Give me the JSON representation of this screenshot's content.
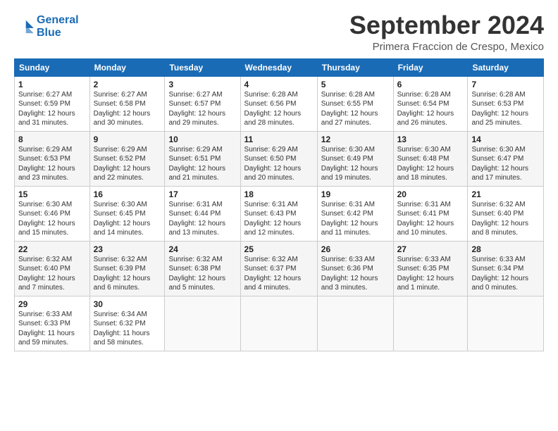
{
  "logo": {
    "line1": "General",
    "line2": "Blue"
  },
  "title": "September 2024",
  "subtitle": "Primera Fraccion de Crespo, Mexico",
  "weekdays": [
    "Sunday",
    "Monday",
    "Tuesday",
    "Wednesday",
    "Thursday",
    "Friday",
    "Saturday"
  ],
  "weeks": [
    [
      {
        "day": "1",
        "info": "Sunrise: 6:27 AM\nSunset: 6:59 PM\nDaylight: 12 hours\nand 31 minutes."
      },
      {
        "day": "2",
        "info": "Sunrise: 6:27 AM\nSunset: 6:58 PM\nDaylight: 12 hours\nand 30 minutes."
      },
      {
        "day": "3",
        "info": "Sunrise: 6:27 AM\nSunset: 6:57 PM\nDaylight: 12 hours\nand 29 minutes."
      },
      {
        "day": "4",
        "info": "Sunrise: 6:28 AM\nSunset: 6:56 PM\nDaylight: 12 hours\nand 28 minutes."
      },
      {
        "day": "5",
        "info": "Sunrise: 6:28 AM\nSunset: 6:55 PM\nDaylight: 12 hours\nand 27 minutes."
      },
      {
        "day": "6",
        "info": "Sunrise: 6:28 AM\nSunset: 6:54 PM\nDaylight: 12 hours\nand 26 minutes."
      },
      {
        "day": "7",
        "info": "Sunrise: 6:28 AM\nSunset: 6:53 PM\nDaylight: 12 hours\nand 25 minutes."
      }
    ],
    [
      {
        "day": "8",
        "info": "Sunrise: 6:29 AM\nSunset: 6:53 PM\nDaylight: 12 hours\nand 23 minutes."
      },
      {
        "day": "9",
        "info": "Sunrise: 6:29 AM\nSunset: 6:52 PM\nDaylight: 12 hours\nand 22 minutes."
      },
      {
        "day": "10",
        "info": "Sunrise: 6:29 AM\nSunset: 6:51 PM\nDaylight: 12 hours\nand 21 minutes."
      },
      {
        "day": "11",
        "info": "Sunrise: 6:29 AM\nSunset: 6:50 PM\nDaylight: 12 hours\nand 20 minutes."
      },
      {
        "day": "12",
        "info": "Sunrise: 6:30 AM\nSunset: 6:49 PM\nDaylight: 12 hours\nand 19 minutes."
      },
      {
        "day": "13",
        "info": "Sunrise: 6:30 AM\nSunset: 6:48 PM\nDaylight: 12 hours\nand 18 minutes."
      },
      {
        "day": "14",
        "info": "Sunrise: 6:30 AM\nSunset: 6:47 PM\nDaylight: 12 hours\nand 17 minutes."
      }
    ],
    [
      {
        "day": "15",
        "info": "Sunrise: 6:30 AM\nSunset: 6:46 PM\nDaylight: 12 hours\nand 15 minutes."
      },
      {
        "day": "16",
        "info": "Sunrise: 6:30 AM\nSunset: 6:45 PM\nDaylight: 12 hours\nand 14 minutes."
      },
      {
        "day": "17",
        "info": "Sunrise: 6:31 AM\nSunset: 6:44 PM\nDaylight: 12 hours\nand 13 minutes."
      },
      {
        "day": "18",
        "info": "Sunrise: 6:31 AM\nSunset: 6:43 PM\nDaylight: 12 hours\nand 12 minutes."
      },
      {
        "day": "19",
        "info": "Sunrise: 6:31 AM\nSunset: 6:42 PM\nDaylight: 12 hours\nand 11 minutes."
      },
      {
        "day": "20",
        "info": "Sunrise: 6:31 AM\nSunset: 6:41 PM\nDaylight: 12 hours\nand 10 minutes."
      },
      {
        "day": "21",
        "info": "Sunrise: 6:32 AM\nSunset: 6:40 PM\nDaylight: 12 hours\nand 8 minutes."
      }
    ],
    [
      {
        "day": "22",
        "info": "Sunrise: 6:32 AM\nSunset: 6:40 PM\nDaylight: 12 hours\nand 7 minutes."
      },
      {
        "day": "23",
        "info": "Sunrise: 6:32 AM\nSunset: 6:39 PM\nDaylight: 12 hours\nand 6 minutes."
      },
      {
        "day": "24",
        "info": "Sunrise: 6:32 AM\nSunset: 6:38 PM\nDaylight: 12 hours\nand 5 minutes."
      },
      {
        "day": "25",
        "info": "Sunrise: 6:32 AM\nSunset: 6:37 PM\nDaylight: 12 hours\nand 4 minutes."
      },
      {
        "day": "26",
        "info": "Sunrise: 6:33 AM\nSunset: 6:36 PM\nDaylight: 12 hours\nand 3 minutes."
      },
      {
        "day": "27",
        "info": "Sunrise: 6:33 AM\nSunset: 6:35 PM\nDaylight: 12 hours\nand 1 minute."
      },
      {
        "day": "28",
        "info": "Sunrise: 6:33 AM\nSunset: 6:34 PM\nDaylight: 12 hours\nand 0 minutes."
      }
    ],
    [
      {
        "day": "29",
        "info": "Sunrise: 6:33 AM\nSunset: 6:33 PM\nDaylight: 11 hours\nand 59 minutes."
      },
      {
        "day": "30",
        "info": "Sunrise: 6:34 AM\nSunset: 6:32 PM\nDaylight: 11 hours\nand 58 minutes."
      },
      {
        "day": "",
        "info": ""
      },
      {
        "day": "",
        "info": ""
      },
      {
        "day": "",
        "info": ""
      },
      {
        "day": "",
        "info": ""
      },
      {
        "day": "",
        "info": ""
      }
    ]
  ]
}
